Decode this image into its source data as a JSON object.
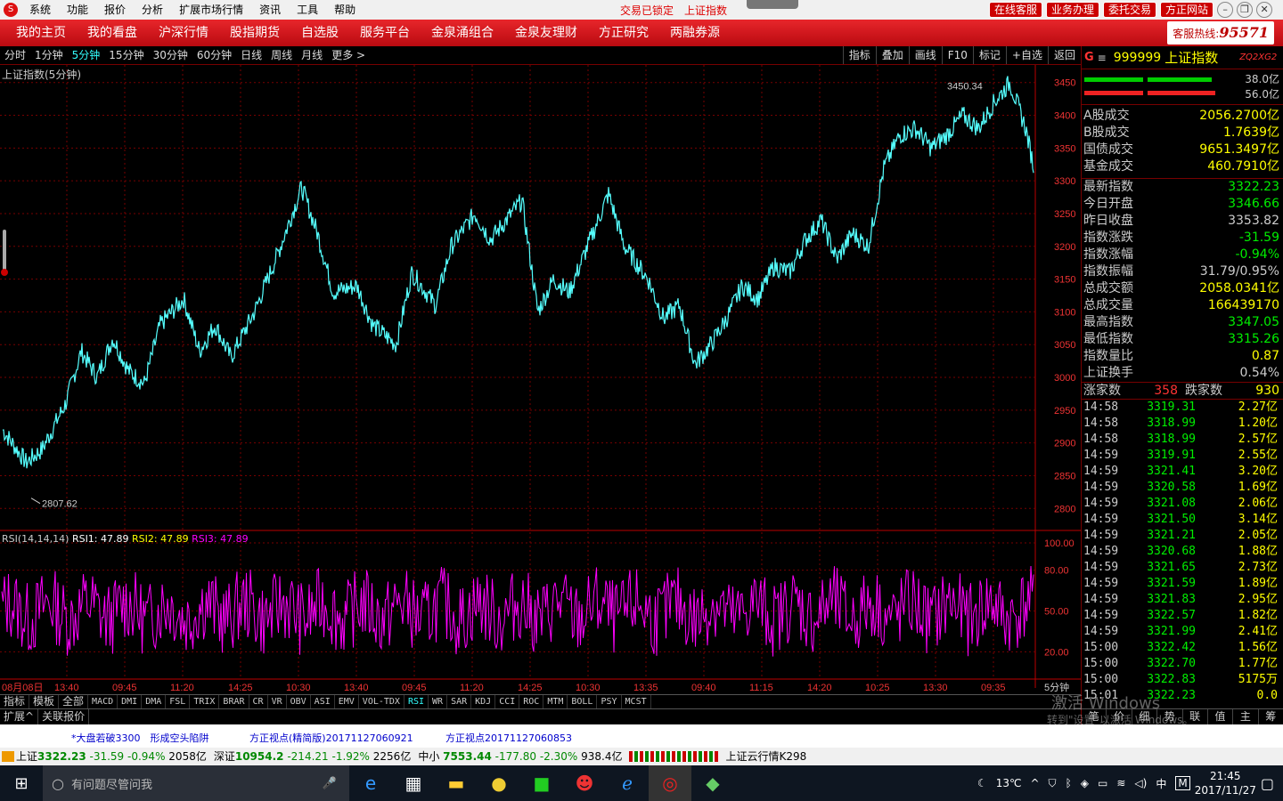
{
  "menubar": {
    "items": [
      "系统",
      "功能",
      "报价",
      "分析",
      "扩展市场行情",
      "资讯",
      "工具",
      "帮助"
    ],
    "lock": "交易已锁定",
    "index": "上证指数",
    "buttons": [
      "在线客服",
      "业务办理",
      "委托交易",
      "方正网站"
    ]
  },
  "navbar": {
    "items": [
      "我的主页",
      "我的看盘",
      "沪深行情",
      "股指期货",
      "自选股",
      "服务平台",
      "金泉涌组合",
      "金泉友理财",
      "方正研究",
      "两融券源"
    ],
    "hotline_label": "客服热线:",
    "hotline": "95571"
  },
  "periods": {
    "items": [
      "分时",
      "1分钟",
      "5分钟",
      "15分钟",
      "30分钟",
      "60分钟",
      "日线",
      "周线",
      "月线",
      "更多 >"
    ],
    "active": "5分钟",
    "tools": [
      "指标",
      "叠加",
      "画线",
      "F10",
      "标记",
      "+自选",
      "返回"
    ]
  },
  "chart": {
    "title": "上证指数(5分钟)",
    "high_label": "3450.34",
    "low_label": "2807.62",
    "rsi_title": "RSI(14,14,14)",
    "rsi1": "RSI1: 47.89",
    "rsi2": "RSI2: 47.89",
    "rsi3": "RSI3: 47.89",
    "price_ticks": [
      "3450",
      "3400",
      "3350",
      "3300",
      "3250",
      "3200",
      "3150",
      "3100",
      "3050",
      "3000",
      "2950",
      "2900",
      "2850",
      "2800"
    ],
    "rsi_ticks": [
      "100.00",
      "80.00",
      "50.00",
      "20.00"
    ],
    "time_labels": [
      "08月08日",
      "13:40",
      "09:45",
      "11:20",
      "14:25",
      "10:30",
      "13:40",
      "09:45",
      "11:20",
      "14:25",
      "10:30",
      "13:35",
      "09:40",
      "11:15",
      "14:20",
      "10:25",
      "13:30",
      "09:35"
    ],
    "period_label": "5分钟",
    "colors": {
      "price": "#5ff",
      "rsi": "#f0f",
      "grid": "#700"
    }
  },
  "chart_data": [
    {
      "type": "line",
      "title": "上证指数(5分钟)",
      "ylim": [
        2780,
        3470
      ],
      "series": [
        {
          "name": "上证指数",
          "points": [
            [
              0,
              2920
            ],
            [
              3,
              2870
            ],
            [
              5,
              2890
            ],
            [
              8,
              2960
            ],
            [
              10,
              3040
            ],
            [
              12,
              3000
            ],
            [
              14,
              3060
            ],
            [
              16,
              3010
            ],
            [
              18,
              2990
            ],
            [
              20,
              3080
            ],
            [
              23,
              3120
            ],
            [
              25,
              3040
            ],
            [
              27,
              3080
            ],
            [
              29,
              3030
            ],
            [
              32,
              3100
            ],
            [
              35,
              3190
            ],
            [
              38,
              3290
            ],
            [
              40,
              3220
            ],
            [
              42,
              3130
            ],
            [
              45,
              3140
            ],
            [
              47,
              3080
            ],
            [
              50,
              3050
            ],
            [
              52,
              3160
            ],
            [
              55,
              3110
            ],
            [
              57,
              3200
            ],
            [
              60,
              3250
            ],
            [
              62,
              3210
            ],
            [
              64,
              3240
            ],
            [
              66,
              3270
            ],
            [
              68,
              3100
            ],
            [
              70,
              3150
            ],
            [
              72,
              3130
            ],
            [
              75,
              3220
            ],
            [
              77,
              3280
            ],
            [
              79,
              3200
            ],
            [
              82,
              3150
            ],
            [
              84,
              3090
            ],
            [
              86,
              3110
            ],
            [
              88,
              3020
            ],
            [
              90,
              3050
            ],
            [
              92,
              3090
            ],
            [
              94,
              3140
            ],
            [
              96,
              3120
            ],
            [
              98,
              3170
            ],
            [
              100,
              3160
            ],
            [
              102,
              3210
            ],
            [
              104,
              3240
            ],
            [
              106,
              3180
            ],
            [
              108,
              3220
            ],
            [
              110,
              3200
            ],
            [
              112,
              3320
            ],
            [
              114,
              3370
            ],
            [
              116,
              3380
            ],
            [
              118,
              3350
            ],
            [
              120,
              3370
            ],
            [
              122,
              3400
            ],
            [
              124,
              3380
            ],
            [
              126,
              3420
            ],
            [
              128,
              3450
            ],
            [
              130,
              3380
            ],
            [
              131,
              3322
            ]
          ]
        }
      ],
      "xlabel": "",
      "ylabel": ""
    },
    {
      "type": "line",
      "title": "RSI(14,14,14)",
      "ylim": [
        0,
        100
      ],
      "series": [
        {
          "name": "RSI1",
          "last": 47.89
        },
        {
          "name": "RSI2",
          "last": 47.89
        },
        {
          "name": "RSI3",
          "last": 47.89
        }
      ]
    }
  ],
  "indicators": {
    "left": [
      "指标",
      "模板",
      "全部"
    ],
    "items": [
      "MACD",
      "DMI",
      "DMA",
      "FSL",
      "TRIX",
      "BRAR",
      "CR",
      "VR",
      "OBV",
      "ASI",
      "EMV",
      "VOL-TDX",
      "RSI",
      "WR",
      "SAR",
      "KDJ",
      "CCI",
      "ROC",
      "MTM",
      "BOLL",
      "PSY",
      "MCST"
    ],
    "active": "RSI",
    "ext": [
      "扩展^",
      "关联报价"
    ]
  },
  "rpanel": {
    "g": "G",
    "code": "999999",
    "name": "上证指数",
    "tag": "ZQ2XG2",
    "bar1": "38.0亿",
    "bar2": "56.0亿",
    "volumes": [
      {
        "k": "A股成交",
        "v": "2056.2700亿"
      },
      {
        "k": "B股成交",
        "v": "1.7639亿"
      },
      {
        "k": "国债成交",
        "v": "9651.3497亿"
      },
      {
        "k": "基金成交",
        "v": "460.7910亿"
      }
    ],
    "stats": [
      {
        "k": "最新指数",
        "v": "3322.23",
        "c": "#0e0"
      },
      {
        "k": "今日开盘",
        "v": "3346.66",
        "c": "#0e0"
      },
      {
        "k": "昨日收盘",
        "v": "3353.82",
        "c": "#ccc"
      },
      {
        "k": "指数涨跌",
        "v": "-31.59",
        "c": "#0e0"
      },
      {
        "k": "指数涨幅",
        "v": "-0.94%",
        "c": "#0e0"
      },
      {
        "k": "指数振幅",
        "v": "31.79/0.95%",
        "c": "#ccc"
      },
      {
        "k": "总成交额",
        "v": "2058.0341亿",
        "c": "#ff0"
      },
      {
        "k": "总成交量",
        "v": "166439170",
        "c": "#ff0"
      },
      {
        "k": "最高指数",
        "v": "3347.05",
        "c": "#0e0"
      },
      {
        "k": "最低指数",
        "v": "3315.26",
        "c": "#0e0"
      },
      {
        "k": "指数量比",
        "v": "0.87",
        "c": "#ff0"
      },
      {
        "k": "上证换手",
        "v": "0.54%",
        "c": "#ccc"
      }
    ],
    "up_label": "涨家数",
    "up": "358",
    "down_label": "跌家数",
    "down": "930",
    "ticks": [
      [
        "14:58",
        "3319.31",
        "2.27亿"
      ],
      [
        "14:58",
        "3318.99",
        "1.20亿"
      ],
      [
        "14:58",
        "3318.99",
        "2.57亿"
      ],
      [
        "14:59",
        "3319.91",
        "2.55亿"
      ],
      [
        "14:59",
        "3321.41",
        "3.20亿"
      ],
      [
        "14:59",
        "3320.58",
        "1.69亿"
      ],
      [
        "14:59",
        "3321.08",
        "2.06亿"
      ],
      [
        "14:59",
        "3321.50",
        "3.14亿"
      ],
      [
        "14:59",
        "3321.21",
        "2.05亿"
      ],
      [
        "14:59",
        "3320.68",
        "1.88亿"
      ],
      [
        "14:59",
        "3321.65",
        "2.73亿"
      ],
      [
        "14:59",
        "3321.59",
        "1.89亿"
      ],
      [
        "14:59",
        "3321.83",
        "2.95亿"
      ],
      [
        "14:59",
        "3322.57",
        "1.82亿"
      ],
      [
        "14:59",
        "3321.99",
        "2.41亿"
      ],
      [
        "15:00",
        "3322.42",
        "1.56亿"
      ],
      [
        "15:00",
        "3322.70",
        "1.77亿"
      ],
      [
        "15:00",
        "3322.83",
        "5175万"
      ],
      [
        "15:01",
        "3322.23",
        "0.0"
      ]
    ],
    "tabs": [
      "笔",
      "价",
      "细",
      "势",
      "联",
      "值",
      "主",
      "筹"
    ]
  },
  "watermark": {
    "title": "激活 Windows",
    "sub": "转到\"设置\"以激活 Windows。"
  },
  "news": [
    "*大盘若破3300　形成空头陷阱",
    "方正视点(精简版)20171127060921",
    "方正视点20171127060853"
  ],
  "status": {
    "sh_label": "上证",
    "sh": "3322.23",
    "sh_chg": "-31.59",
    "sh_pct": "-0.94%",
    "sh_amt": "2058亿",
    "sz_label": "深证",
    "sz": "10954.2",
    "sz_chg": "-214.21",
    "sz_pct": "-1.92%",
    "sz_amt": "2256亿",
    "zx_label": "中小",
    "zx": "7553.44",
    "zx_chg": "-177.80",
    "zx_pct": "-2.30%",
    "zx_amt": "938.4亿",
    "cloud": "上证云行情K298"
  },
  "taskbar": {
    "search": "有问题尽管问我",
    "weather": "13℃",
    "lang": "中",
    "ime": "M",
    "time": "21:45",
    "date": "2017/11/27"
  }
}
